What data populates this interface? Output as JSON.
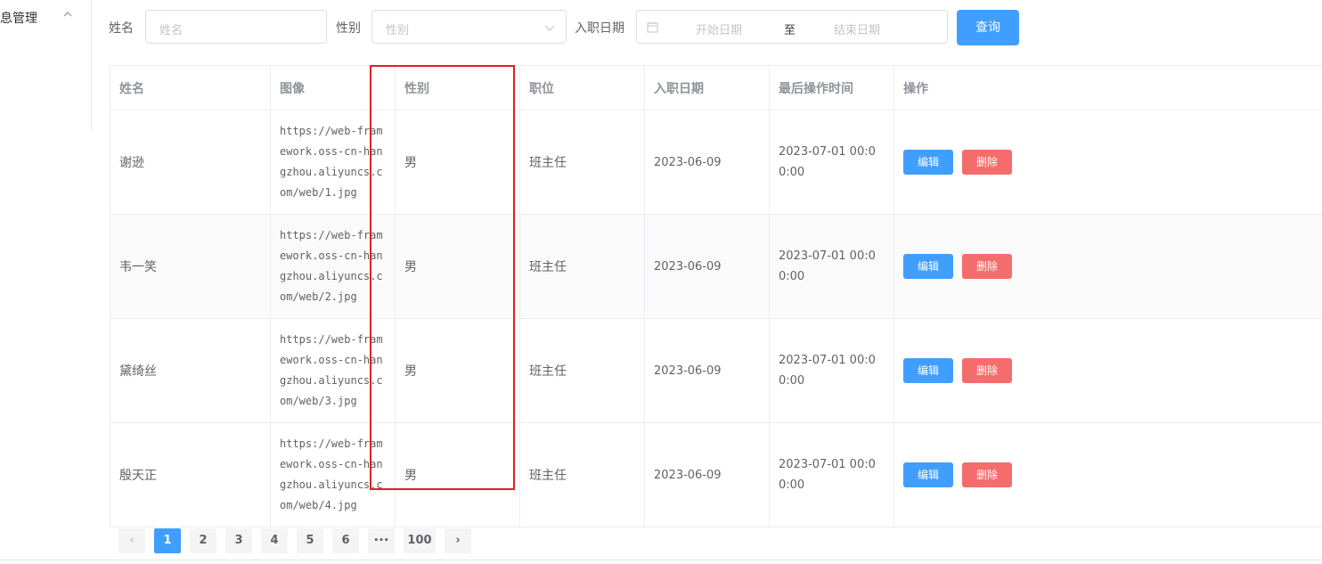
{
  "sidebar": {
    "menu_title": "息管理",
    "chevron_icon": "chevron-up-icon"
  },
  "filters": {
    "name_label": "姓名",
    "name_placeholder": "姓名",
    "gender_label": "性别",
    "gender_placeholder": "性别",
    "date_label": "入职日期",
    "start_placeholder": "开始日期",
    "separator": "至",
    "end_placeholder": "结束日期",
    "query_button": "查询"
  },
  "table": {
    "headers": [
      "姓名",
      "图像",
      "性别",
      "职位",
      "入职日期",
      "最后操作时间",
      "操作"
    ],
    "rows": [
      {
        "name": "谢逊",
        "image": "https://web-framework.oss-cn-hangzhou.aliyuncs.com/web/1.jpg",
        "gender": "男",
        "job": "班主任",
        "entry": "2023-06-09",
        "updated": "2023-07-01 00:00:00"
      },
      {
        "name": "韦一笑",
        "image": "https://web-framework.oss-cn-hangzhou.aliyuncs.com/web/2.jpg",
        "gender": "男",
        "job": "班主任",
        "entry": "2023-06-09",
        "updated": "2023-07-01 00:00:00"
      },
      {
        "name": "黛绮丝",
        "image": "https://web-framework.oss-cn-hangzhou.aliyuncs.com/web/3.jpg",
        "gender": "男",
        "job": "班主任",
        "entry": "2023-06-09",
        "updated": "2023-07-01 00:00:00"
      },
      {
        "name": "殷天正",
        "image": "https://web-framework.oss-cn-hangzhou.aliyuncs.com/web/4.jpg",
        "gender": "男",
        "job": "班主任",
        "entry": "2023-06-09",
        "updated": "2023-07-01 00:00:00"
      }
    ],
    "edit_label": "编辑",
    "delete_label": "删除"
  },
  "pagination": {
    "prev": "‹",
    "pages": [
      "1",
      "2",
      "3",
      "4",
      "5",
      "6"
    ],
    "ellipsis": "•••",
    "last": "100",
    "next": "›",
    "current": "1"
  },
  "colors": {
    "primary": "#409eff",
    "danger": "#f56c6c",
    "highlight": "#e02020"
  }
}
